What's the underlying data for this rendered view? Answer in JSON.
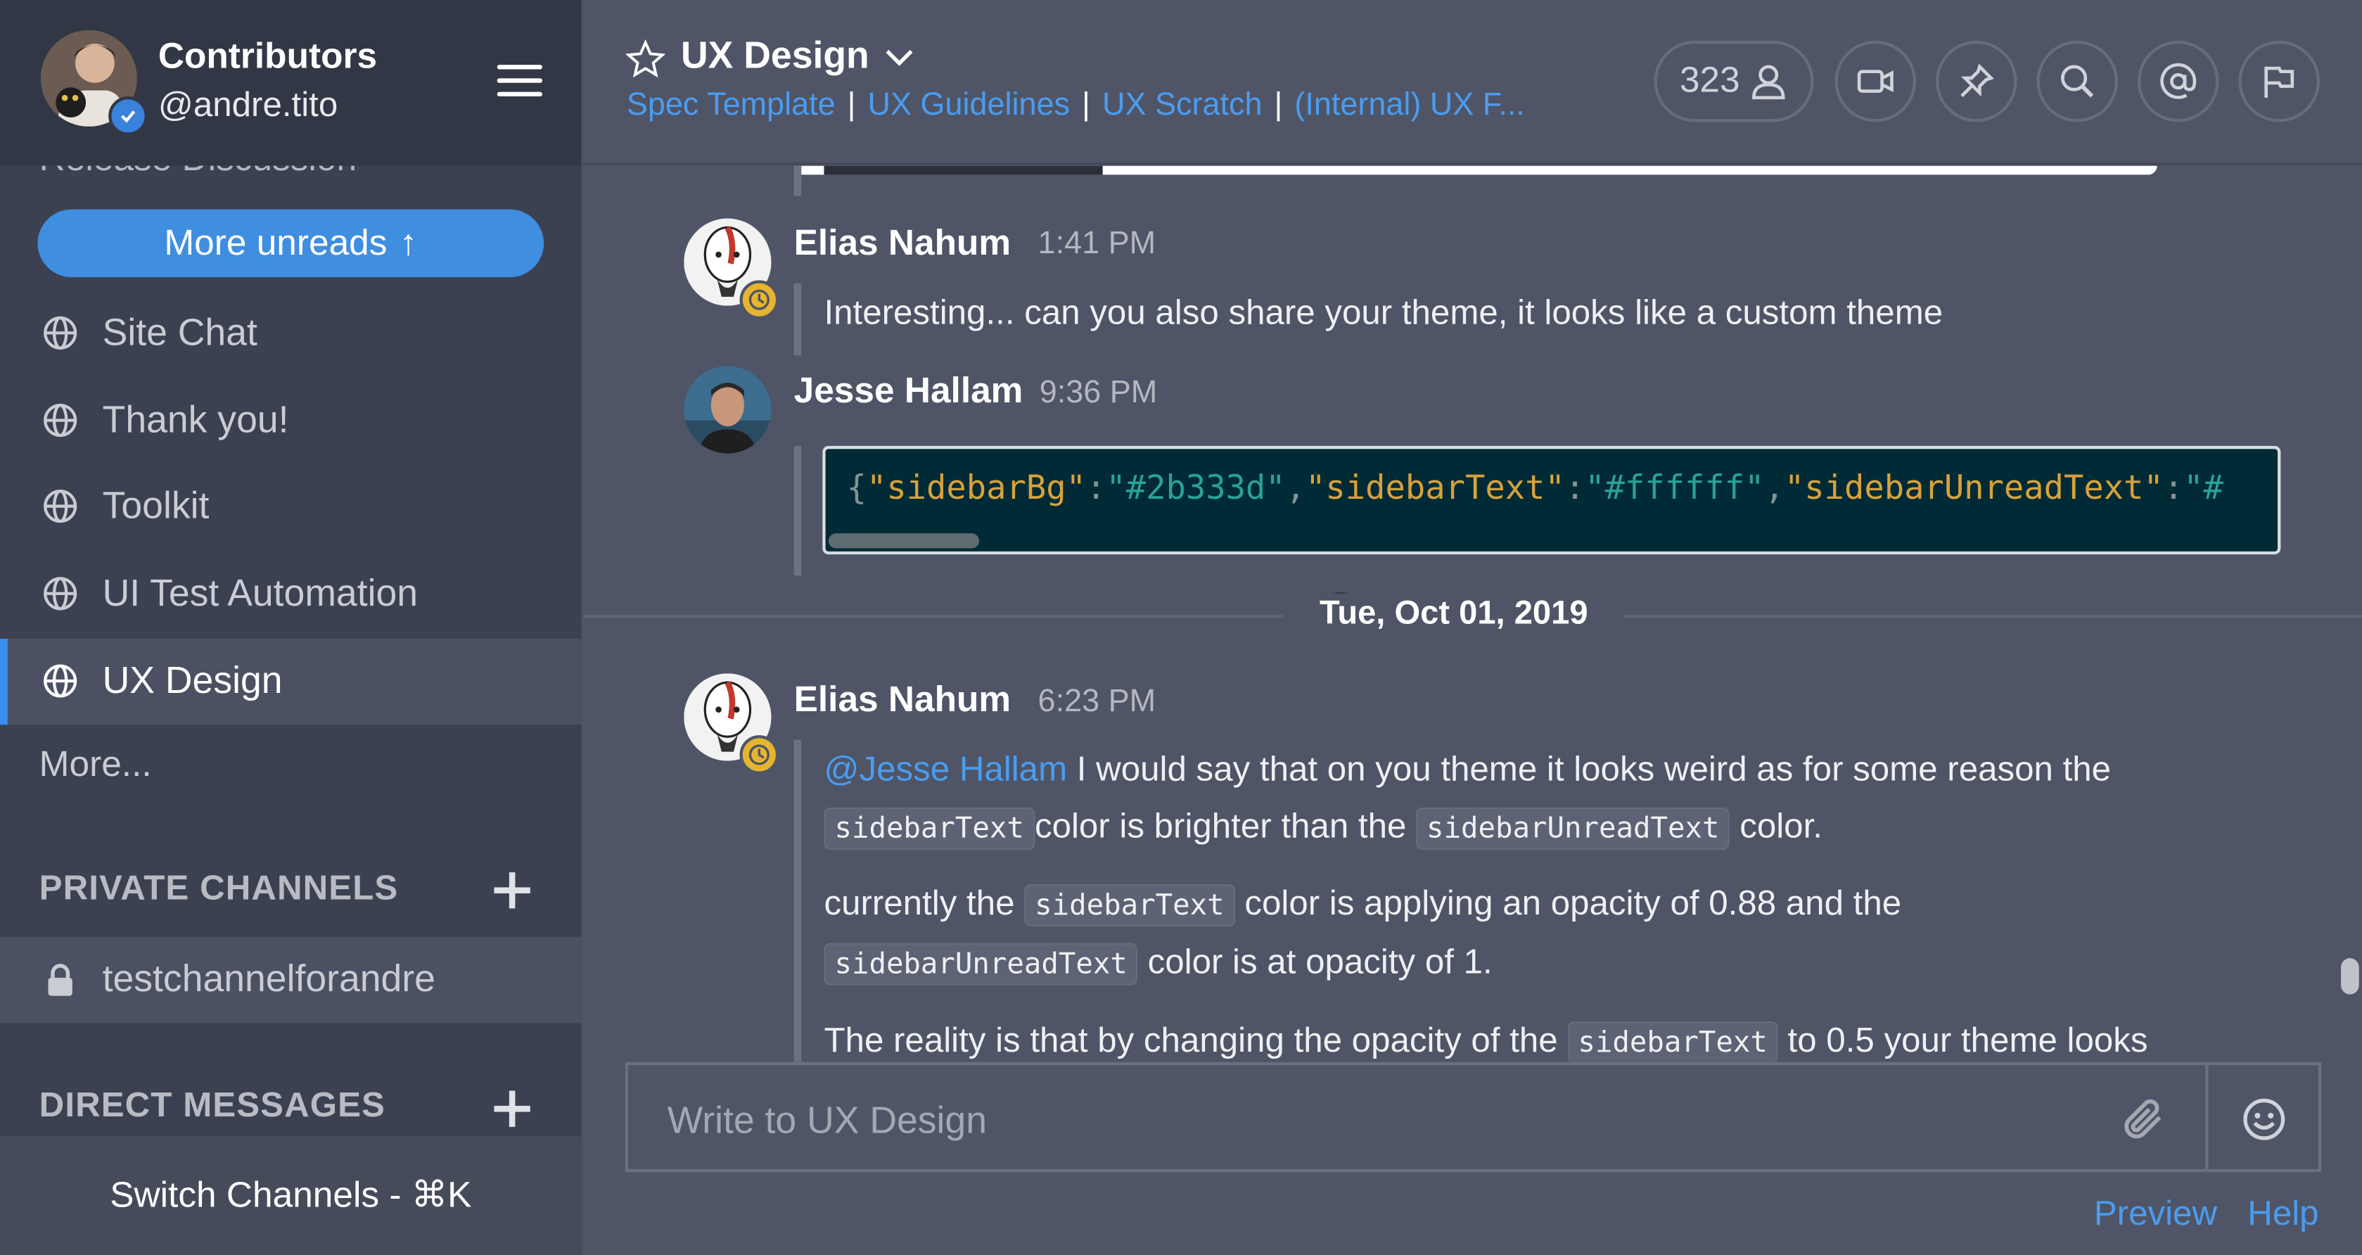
{
  "sidebar": {
    "team_name": "Contributors",
    "user_name": "@andre.tito",
    "cut_item": "Release Discussion",
    "more_unreads": "More unreads",
    "public_channels": [
      {
        "label": "Site Chat"
      },
      {
        "label": "Thank you!"
      },
      {
        "label": "Toolkit"
      },
      {
        "label": "UI Test Automation"
      },
      {
        "label": "UX Design",
        "active": true
      }
    ],
    "more_link": "More...",
    "private_title": "PRIVATE CHANNELS",
    "private_channels": [
      {
        "label": "testchannelforandre"
      }
    ],
    "direct_title": "DIRECT MESSAGES",
    "switch_channels": "Switch Channels - ⌘K"
  },
  "header": {
    "channel_title": "UX Design",
    "bookmarks": [
      "Spec Template",
      "UX Guidelines",
      "UX Scratch",
      "(Internal) UX F..."
    ],
    "member_count": "323",
    "icons": [
      "member-icon",
      "video-icon",
      "pin-icon",
      "search-icon",
      "at-mention-icon",
      "flag-icon"
    ]
  },
  "posts": [
    {
      "author": "Elias Nahum",
      "time": "1:41 PM",
      "status": "away",
      "text": "Interesting... can you also share your theme, it looks like a custom theme"
    },
    {
      "author": "Jesse Hallam",
      "time": "9:36 PM",
      "status": "verified",
      "code": [
        {
          "t": "{",
          "c": "p"
        },
        {
          "t": "\"sidebarBg\"",
          "c": "k"
        },
        {
          "t": ":",
          "c": "p"
        },
        {
          "t": "\"#2b333d\"",
          "c": "v"
        },
        {
          "t": ",",
          "c": "p"
        },
        {
          "t": "\"sidebarText\"",
          "c": "k"
        },
        {
          "t": ":",
          "c": "p"
        },
        {
          "t": "\"#ffffff\"",
          "c": "v"
        },
        {
          "t": ",",
          "c": "p"
        },
        {
          "t": "\"sidebarUnreadText\"",
          "c": "k"
        },
        {
          "t": ":",
          "c": "p"
        },
        {
          "t": "\"#",
          "c": "v"
        }
      ]
    }
  ],
  "date_separator": "Tue, Oct 01, 2019",
  "post3": {
    "author": "Elias Nahum",
    "time": "6:23 PM",
    "mention": "@Jesse Hallam",
    "l1": " I would say that on you theme it looks weird as for some reason the",
    "c_sidebarText": "sidebarText",
    "c_sidebarUnreadText": "sidebarUnreadText",
    "l2a": "color is brighter than the ",
    "l2b": " color.",
    "l3a": "currently the ",
    "l3b": " color is applying an opacity of 0.88 and the",
    "l4b": " color is at opacity of 1.",
    "l5a": "The reality is that by changing the opacity of the ",
    "l5b": " to 0.5 your theme looks"
  },
  "composer": {
    "placeholder": "Write to UX Design",
    "preview": "Preview",
    "help": "Help"
  },
  "colors": {
    "sidebar_bg": "#3c4151",
    "sidebar_header_bg": "#323745",
    "center_bg": "#4f5566",
    "link": "#4a9cf0",
    "button": "#3f8ee0",
    "away": "#e6b52f",
    "online": "#3b82dd"
  }
}
